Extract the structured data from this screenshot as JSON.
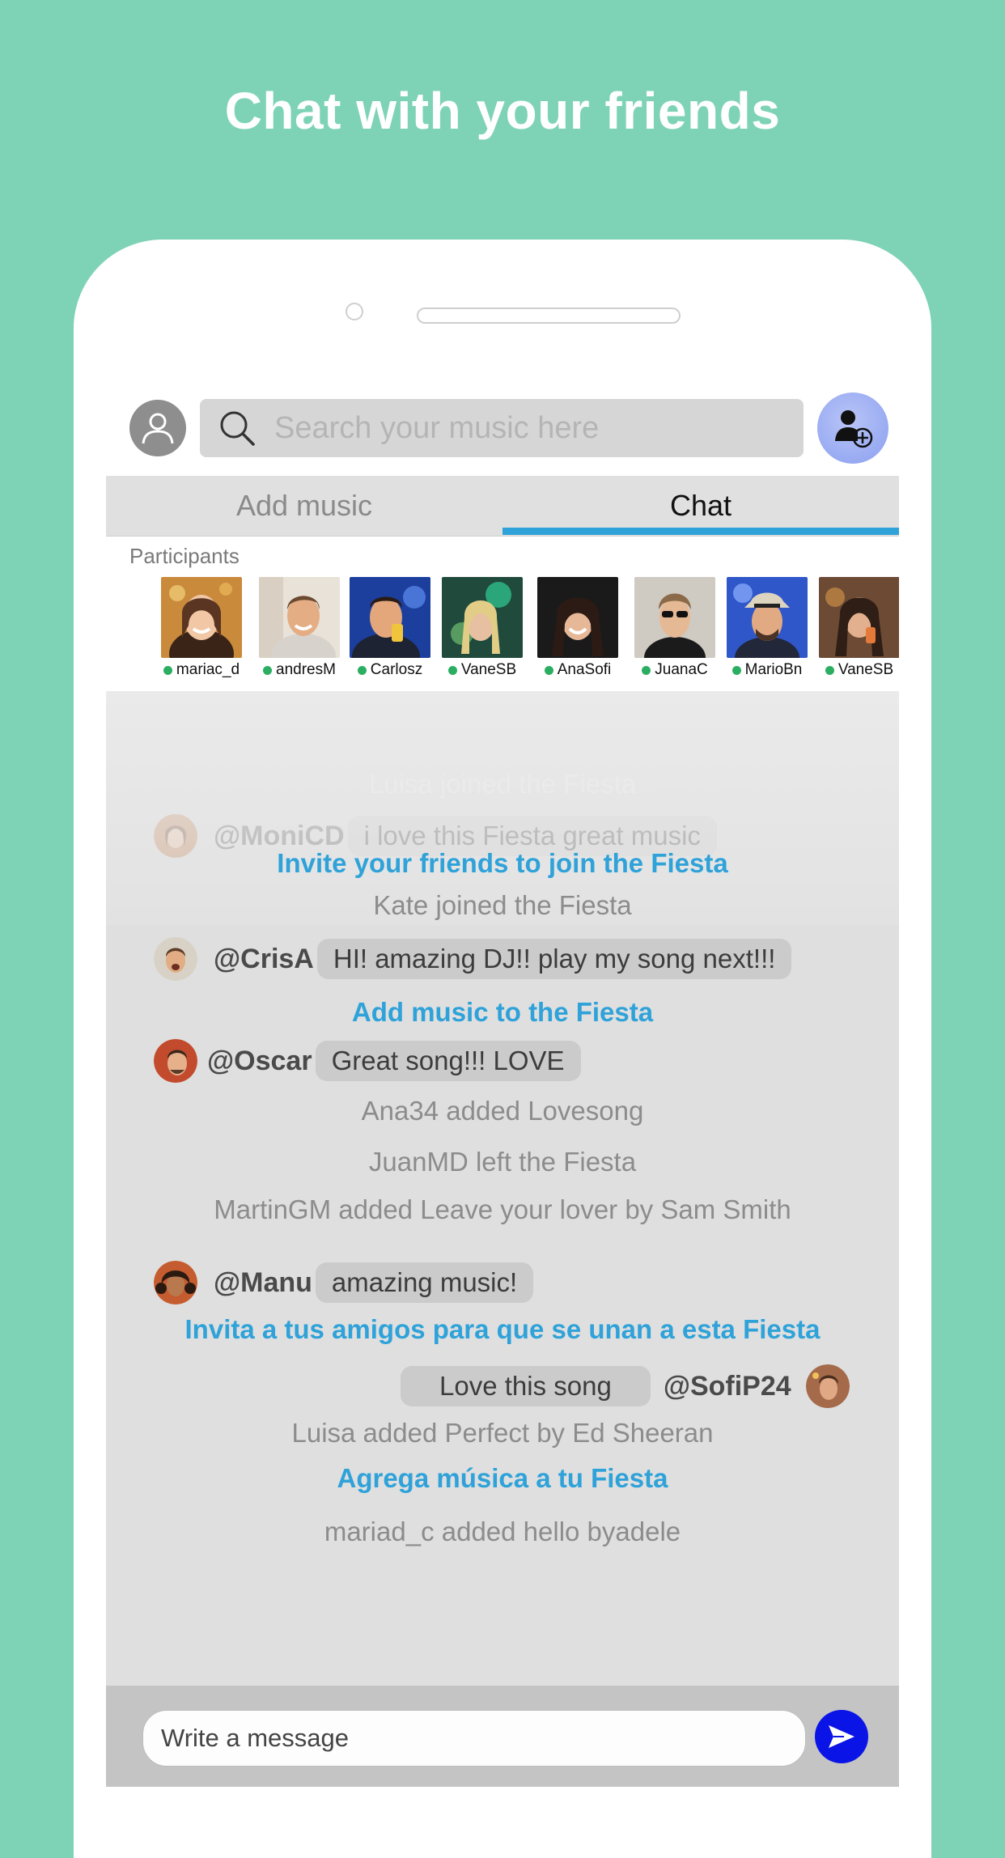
{
  "colors": {
    "background": "#7ed3b6",
    "accent": "#2ea2d9",
    "online": "#2cae62",
    "send_button": "#0a14e6"
  },
  "headline": "Chat with your friends",
  "header": {
    "profile_icon": "user-icon",
    "search_icon": "search-icon",
    "search_placeholder": "Search your music here",
    "add_user_icon": "add-user-icon"
  },
  "tabs": [
    {
      "label": "Add music",
      "active": false
    },
    {
      "label": "Chat",
      "active": true
    }
  ],
  "participants": {
    "label": "Participants",
    "people": [
      {
        "name": "mariac_d",
        "online": true
      },
      {
        "name": "andresM",
        "online": true
      },
      {
        "name": "Carlosz",
        "online": true
      },
      {
        "name": "VaneSB",
        "online": true
      },
      {
        "name": "AnaSofi",
        "online": true
      },
      {
        "name": "JuanaC",
        "online": true
      },
      {
        "name": "MarioBn",
        "online": true
      },
      {
        "name": "VaneSB",
        "online": true
      }
    ]
  },
  "chat": {
    "feed": [
      {
        "kind": "system",
        "text": "Luisa joined the Fiesta"
      },
      {
        "kind": "message",
        "handle": "@MoniCD",
        "text": "i love this Fiesta great music"
      },
      {
        "kind": "cta",
        "text": "Invite your friends to join the Fiesta"
      },
      {
        "kind": "system",
        "text": "Kate joined the Fiesta"
      },
      {
        "kind": "message",
        "handle": "@CrisA",
        "text": "HI! amazing DJ!! play my song next!!!"
      },
      {
        "kind": "cta",
        "text": "Add music to the Fiesta"
      },
      {
        "kind": "message",
        "handle": "@Oscar",
        "text": "Great song!!! LOVE"
      },
      {
        "kind": "system",
        "text": "Ana34 added Lovesong"
      },
      {
        "kind": "system",
        "text": "JuanMD left the Fiesta"
      },
      {
        "kind": "system",
        "text": "MartinGM  added Leave your lover by Sam Smith"
      },
      {
        "kind": "message",
        "handle": "@Manu",
        "text": "amazing music!"
      },
      {
        "kind": "cta",
        "text": "Invita a tus amigos para que se unan a esta Fiesta"
      },
      {
        "kind": "message_own",
        "handle": "@SofiP24",
        "text": "Love this song"
      },
      {
        "kind": "system",
        "text": "Luisa added Perfect by Ed Sheeran"
      },
      {
        "kind": "cta",
        "text": "Agrega música a tu Fiesta"
      },
      {
        "kind": "system",
        "text": "mariad_c added hello byadele"
      }
    ]
  },
  "composer": {
    "placeholder": "Write a message",
    "send_icon": "send-icon"
  }
}
